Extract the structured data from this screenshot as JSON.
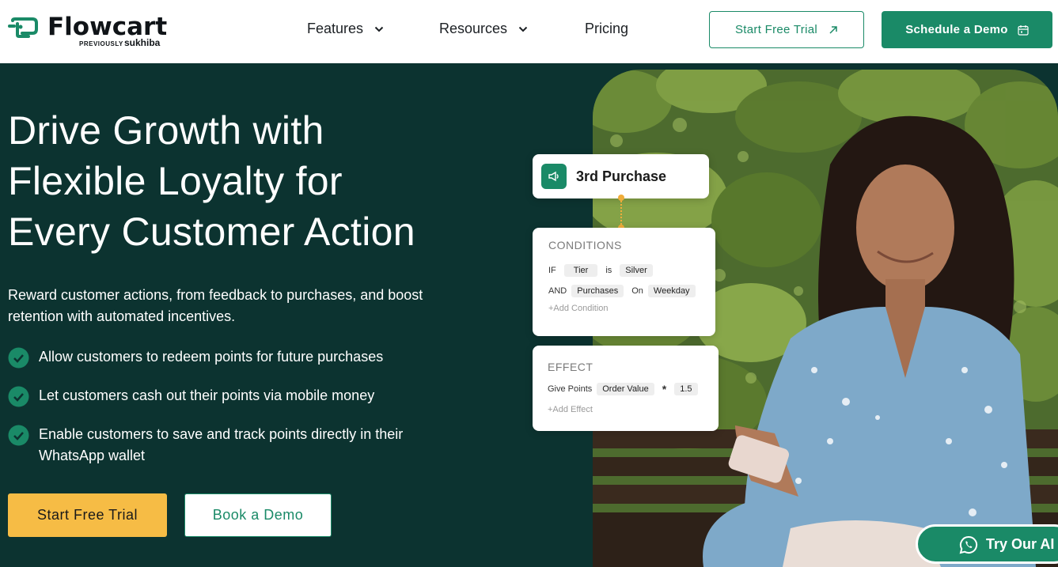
{
  "header": {
    "logo_word": "Flowcart",
    "logo_previously": "PREVIOUSLY",
    "logo_brand": "sukhiba",
    "nav": [
      {
        "label": "Features"
      },
      {
        "label": "Resources"
      },
      {
        "label": "Pricing"
      }
    ],
    "trial_label": "Start Free Trial",
    "demo_label": "Schedule a Demo"
  },
  "hero": {
    "title_lines": [
      "Drive Growth with",
      "Flexible Loyalty for",
      "Every Customer Action"
    ],
    "subtitle": "Reward customer actions, from feedback to purchases, and boost retention with automated incentives.",
    "bullets": [
      "Allow customers to redeem points for  future purchases",
      "Let customers cash out their points via mobile money",
      "Enable customers to save and track points directly in their WhatsApp wallet"
    ],
    "cta_trial": "Start Free Trial",
    "cta_demo": "Book a Demo"
  },
  "rule_cards": {
    "trigger": "3rd Purchase",
    "conditions": {
      "heading": "CONDITIONS",
      "row1": {
        "if": "IF",
        "field": "Tier",
        "op": "is",
        "value": "Silver"
      },
      "row2": {
        "and": "AND",
        "field": "Purchases",
        "op": "On",
        "value": "Weekday"
      },
      "add": "+Add Condition"
    },
    "effect": {
      "heading": "EFFECT",
      "action": "Give Points",
      "field": "Order Value",
      "op": "*",
      "value": "1.5",
      "add": "+Add Effect"
    }
  },
  "whatsapp": {
    "label": "Try Our AI"
  },
  "colors": {
    "hero_bg": "#0c3330",
    "brand_green": "#1a8a67",
    "cta_yellow": "#f6bc45",
    "connector_orange": "#f0ad3a"
  },
  "icons": [
    "flowcart-logo-icon",
    "chevron-down-icon",
    "arrow-up-right-icon",
    "calendar-icon",
    "check-circle-icon",
    "megaphone-icon",
    "whatsapp-icon"
  ]
}
